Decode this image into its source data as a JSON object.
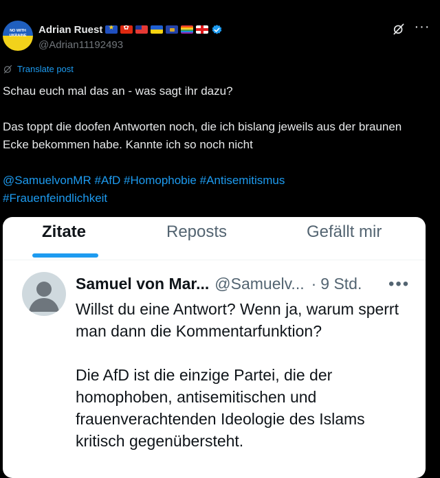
{
  "author": {
    "avatar_text": "NO WITH UKRAINE",
    "name": "Adrian Ruest",
    "handle": "@Adrian11192493",
    "flags": [
      "eu-flag",
      "hong-kong-flag",
      "taiwan-flag",
      "ukraine-flag",
      "kosovo-flag",
      "rainbow-flag",
      "georgia-flag"
    ],
    "verified": true
  },
  "translate_label": "Translate post",
  "post": {
    "line1": "Schau euch mal das an - was sagt ihr dazu?",
    "line2": "Das toppt die doofen Antworten noch, die ich bislang jeweils aus der braunen Ecke bekommen habe. Kannte ich so noch nicht",
    "mentions": [
      "@SamuelvonMR",
      "#AfD",
      "#Homophobie",
      "#Antisemitismus",
      "#Frauenfeindlichkeit"
    ]
  },
  "embed": {
    "tabs": [
      "Zitate",
      "Reposts",
      "Gefällt mir"
    ],
    "reply": {
      "name": "Samuel von Mar...",
      "handle": "@Samuelv...",
      "dot": "·",
      "time": "9 Std.",
      "more": "•••",
      "paragraph1": "Willst du eine Antwort? Wenn ja, warum sperrt man dann die Kommentarfunktion?",
      "paragraph2": "Die AfD ist die einzige Partei, die der homophoben, antisemitischen und frauenverachtenden Ideologie des Islams kritisch gegenübersteht."
    }
  },
  "colors": {
    "background": "#000000",
    "text": "#e7e9ea",
    "muted": "#71767b",
    "link": "#1d9bf0"
  }
}
